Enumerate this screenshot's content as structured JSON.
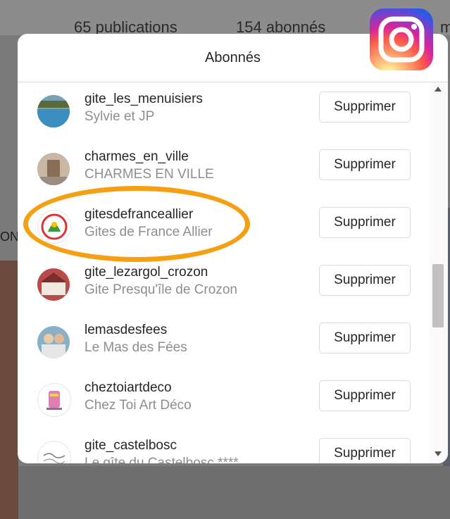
{
  "background": {
    "publications": "65 publications",
    "abonnes": "154 abonnés",
    "partial_right": "m",
    "partial_left": "ON"
  },
  "modal": {
    "title": "Abonnés"
  },
  "followers": [
    {
      "username": "gite_les_menuisiers",
      "fullname": "Sylvie et JP",
      "button": "Supprimer",
      "avatar_icon": "pool-photo-avatar"
    },
    {
      "username": "charmes_en_ville",
      "fullname": "CHARMES EN VILLE",
      "button": "Supprimer",
      "avatar_icon": "house-photo-avatar"
    },
    {
      "username": "gitesdefranceallier",
      "fullname": "Gites de France Allier",
      "button": "Supprimer",
      "avatar_icon": "gites-de-france-logo-avatar"
    },
    {
      "username": "gite_lezargol_crozon",
      "fullname": "Gite Presqu'île de Crozon",
      "button": "Supprimer",
      "avatar_icon": "house-photo-avatar"
    },
    {
      "username": "lemasdesfees",
      "fullname": "Le Mas des Fées",
      "button": "Supprimer",
      "avatar_icon": "people-photo-avatar"
    },
    {
      "username": "cheztoiartdeco",
      "fullname": "Chez Toi Art Déco",
      "button": "Supprimer",
      "avatar_icon": "art-deco-logo-avatar"
    },
    {
      "username": "gite_castelbosc",
      "fullname": "Le gîte du Castelbosc ****",
      "button": "Supprimer",
      "avatar_icon": "castelbosc-logo-avatar"
    }
  ],
  "colors": {
    "highlight": "#f5a012",
    "text_primary": "#262626",
    "text_secondary": "#8e8e8e",
    "border": "#dbdbdb"
  },
  "logo": "instagram-logo"
}
